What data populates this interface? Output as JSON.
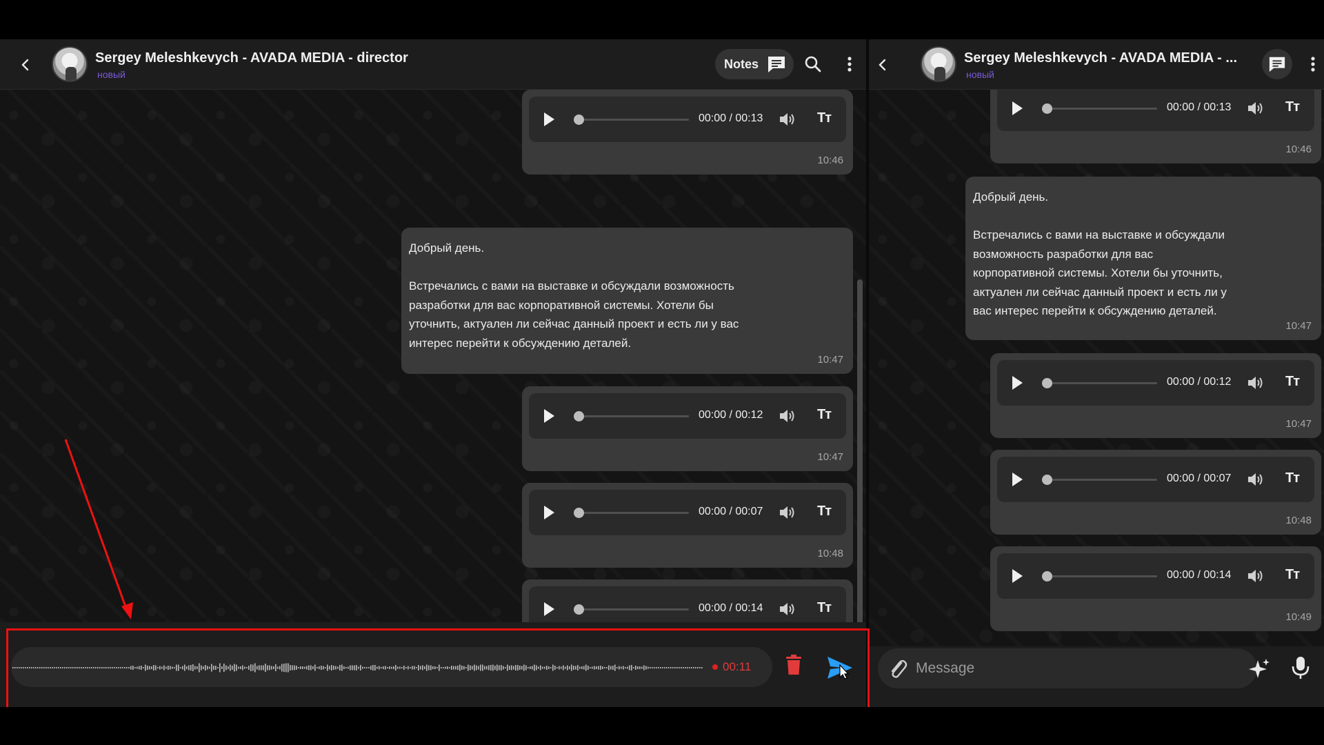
{
  "left_header": {
    "title": "Sergey Meleshkevych - AVADA MEDIA - director",
    "status": "новый",
    "notes_label": "Notes"
  },
  "right_header": {
    "title": "Sergey Meleshkevych - AVADA MEDIA - ...",
    "status": "новый"
  },
  "messages": [
    {
      "type": "voice",
      "player_time": "00:00 / 00:13",
      "time": "10:46"
    },
    {
      "type": "text",
      "text": "Добрый день.\n\nВстречались с вами на выставке и обсуждали возможность разработки для вас корпоративной системы. Хотели бы уточнить, актуален ли сейчас данный проект и есть ли у вас интерес перейти к обсуждению деталей.",
      "time": "10:47"
    },
    {
      "type": "voice",
      "player_time": "00:00 / 00:12",
      "time": "10:47"
    },
    {
      "type": "voice",
      "player_time": "00:00 / 00:07",
      "time": "10:48"
    },
    {
      "type": "voice",
      "player_time": "00:00 / 00:14",
      "time": "10:49"
    }
  ],
  "left_text_wrapped": "Добрый день.\n\nВстречались с вами на выставке и обсуждали возможность\nразработки для вас корпоративной системы. Хотели бы\nуточнить, актуален ли сейчас данный проект и есть ли у вас\nинтерес перейти к обсуждению деталей.",
  "right_text_wrapped": "Добрый день.\n\nВстречались с вами на выставке и обсуждали\nвозможность разработки для вас\nкорпоративной системы. Хотели бы уточнить,\nактуален ли сейчас данный проект и есть ли у\nвас интерес перейти к обсуждению деталей.",
  "player_text_label": "Tт",
  "recording": {
    "elapsed": "00:11"
  },
  "composer": {
    "placeholder": "Message"
  },
  "colors": {
    "accent_status": "#7a5ad6",
    "recording_red": "#e23b3b",
    "highlight_red": "#ee1111",
    "send_blue": "#2a9df4"
  },
  "icons": {
    "back": "chevron-left-icon",
    "notes": "chat-bubble-icon",
    "search": "search-icon",
    "menu": "more-vertical-icon",
    "play": "play-icon",
    "volume": "volume-icon",
    "text": "text-size-icon",
    "trash": "trash-icon",
    "send": "send-icon",
    "attach": "paperclip-icon",
    "ai": "sparkle-icon",
    "mic": "microphone-icon"
  }
}
